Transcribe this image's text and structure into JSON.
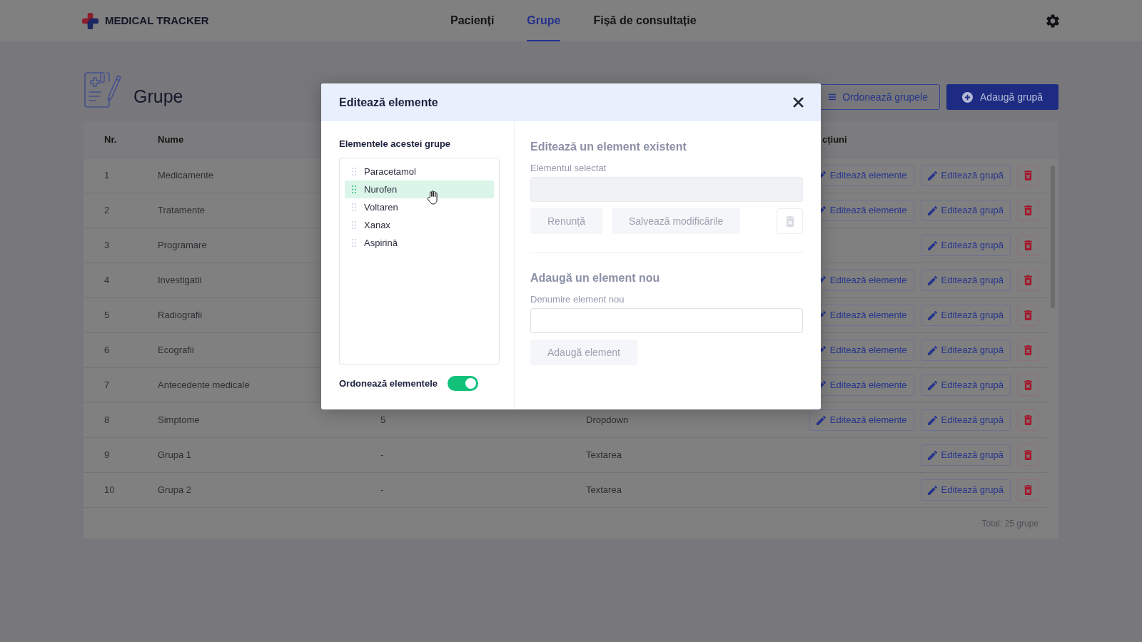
{
  "header": {
    "logo": "MEDICAL TRACKER",
    "nav": [
      {
        "label": "Pacienți",
        "selected": false
      },
      {
        "label": "Grupe",
        "selected": true
      },
      {
        "label": "Fișă de consultație",
        "selected": false
      }
    ]
  },
  "page": {
    "title": "Grupe",
    "buttons": [
      {
        "kind": "outline",
        "label": "Ordonează grupele"
      },
      {
        "kind": "primary",
        "label": "Adaugă grupă"
      }
    ]
  },
  "table": {
    "columns": {
      "nr": "Nr.",
      "name": "Nume",
      "actions": "cțiuni"
    },
    "rows": [
      {
        "nr": "1",
        "name": "Medicamente",
        "actions": [
          {
            "kind": "edit",
            "label": "Editează elemente"
          },
          {
            "kind": "edit",
            "label": "Editează grupă"
          },
          {
            "kind": "delete"
          }
        ]
      },
      {
        "nr": "2",
        "name": "Tratamente",
        "actions": [
          {
            "kind": "edit",
            "label": "Editează elemente"
          },
          {
            "kind": "edit",
            "label": "Editează grupă"
          },
          {
            "kind": "delete"
          }
        ]
      },
      {
        "nr": "3",
        "name": "Programare",
        "actions": [
          {
            "kind": "edit",
            "label": "Editează grupă"
          },
          {
            "kind": "delete"
          }
        ]
      },
      {
        "nr": "4",
        "name": "Investigatii",
        "actions": [
          {
            "kind": "edit",
            "label": "Editează elemente"
          },
          {
            "kind": "edit",
            "label": "Editează grupă"
          },
          {
            "kind": "delete"
          }
        ]
      },
      {
        "nr": "5",
        "name": "Radiografii",
        "actions": [
          {
            "kind": "edit",
            "label": "Editează elemente"
          },
          {
            "kind": "edit",
            "label": "Editează grupă"
          },
          {
            "kind": "delete"
          }
        ]
      },
      {
        "nr": "6",
        "name": "Ecografii",
        "actions": [
          {
            "kind": "edit",
            "label": "Editează elemente"
          },
          {
            "kind": "edit",
            "label": "Editează grupă"
          },
          {
            "kind": "delete"
          }
        ]
      },
      {
        "nr": "7",
        "name": "Antecedente medicale",
        "actions": [
          {
            "kind": "edit",
            "label": "Editează elemente"
          },
          {
            "kind": "edit",
            "label": "Editează grupă"
          },
          {
            "kind": "delete"
          }
        ]
      },
      {
        "nr": "8",
        "name": "Simptome",
        "column_3": "5",
        "column_4": "Dropdown",
        "actions": [
          {
            "kind": "edit",
            "label": "Editează elemente"
          },
          {
            "kind": "edit",
            "label": "Editează grupă"
          },
          {
            "kind": "delete"
          }
        ]
      },
      {
        "nr": "9",
        "name": "Grupa 1",
        "column_3": "-",
        "column_4": "Textarea",
        "actions": [
          {
            "kind": "edit",
            "label": "Editează grupă"
          },
          {
            "kind": "delete"
          }
        ]
      },
      {
        "nr": "10",
        "name": "Grupa 2",
        "column_3": "-",
        "column_4": "Textarea",
        "actions": [
          {
            "kind": "edit",
            "label": "Editează grupă"
          },
          {
            "kind": "delete"
          }
        ]
      }
    ],
    "footer": "Total: 25 grupe"
  },
  "modal": {
    "title": "Editează elemente",
    "list": {
      "label": "Elementele acestei grupe",
      "items": [
        {
          "label": "Paracetamol",
          "selected": false
        },
        {
          "label": "Nurofen",
          "selected": true
        },
        {
          "label": "Voltaren",
          "selected": false
        },
        {
          "label": "Xanax",
          "selected": false
        },
        {
          "label": "Aspirină",
          "selected": false
        }
      ]
    },
    "reorder": {
      "label": "Ordonează elementele",
      "on": true
    },
    "edit": {
      "heading": "Editează un element existent",
      "field_label": "Elementul selectat",
      "field": {
        "disabled": true
      },
      "buttons": [
        {
          "kind": "text",
          "label": "Renunță",
          "disabled": true
        },
        {
          "kind": "text",
          "label": "Salvează modificările",
          "disabled": true
        },
        {
          "kind": "delete",
          "disabled": true
        }
      ]
    },
    "add": {
      "heading": "Adaugă un element nou",
      "field_label": "Denumire element nou",
      "field": {
        "disabled": false
      },
      "buttons": [
        {
          "kind": "text",
          "label": "Adaugă element",
          "disabled": true
        }
      ]
    }
  }
}
